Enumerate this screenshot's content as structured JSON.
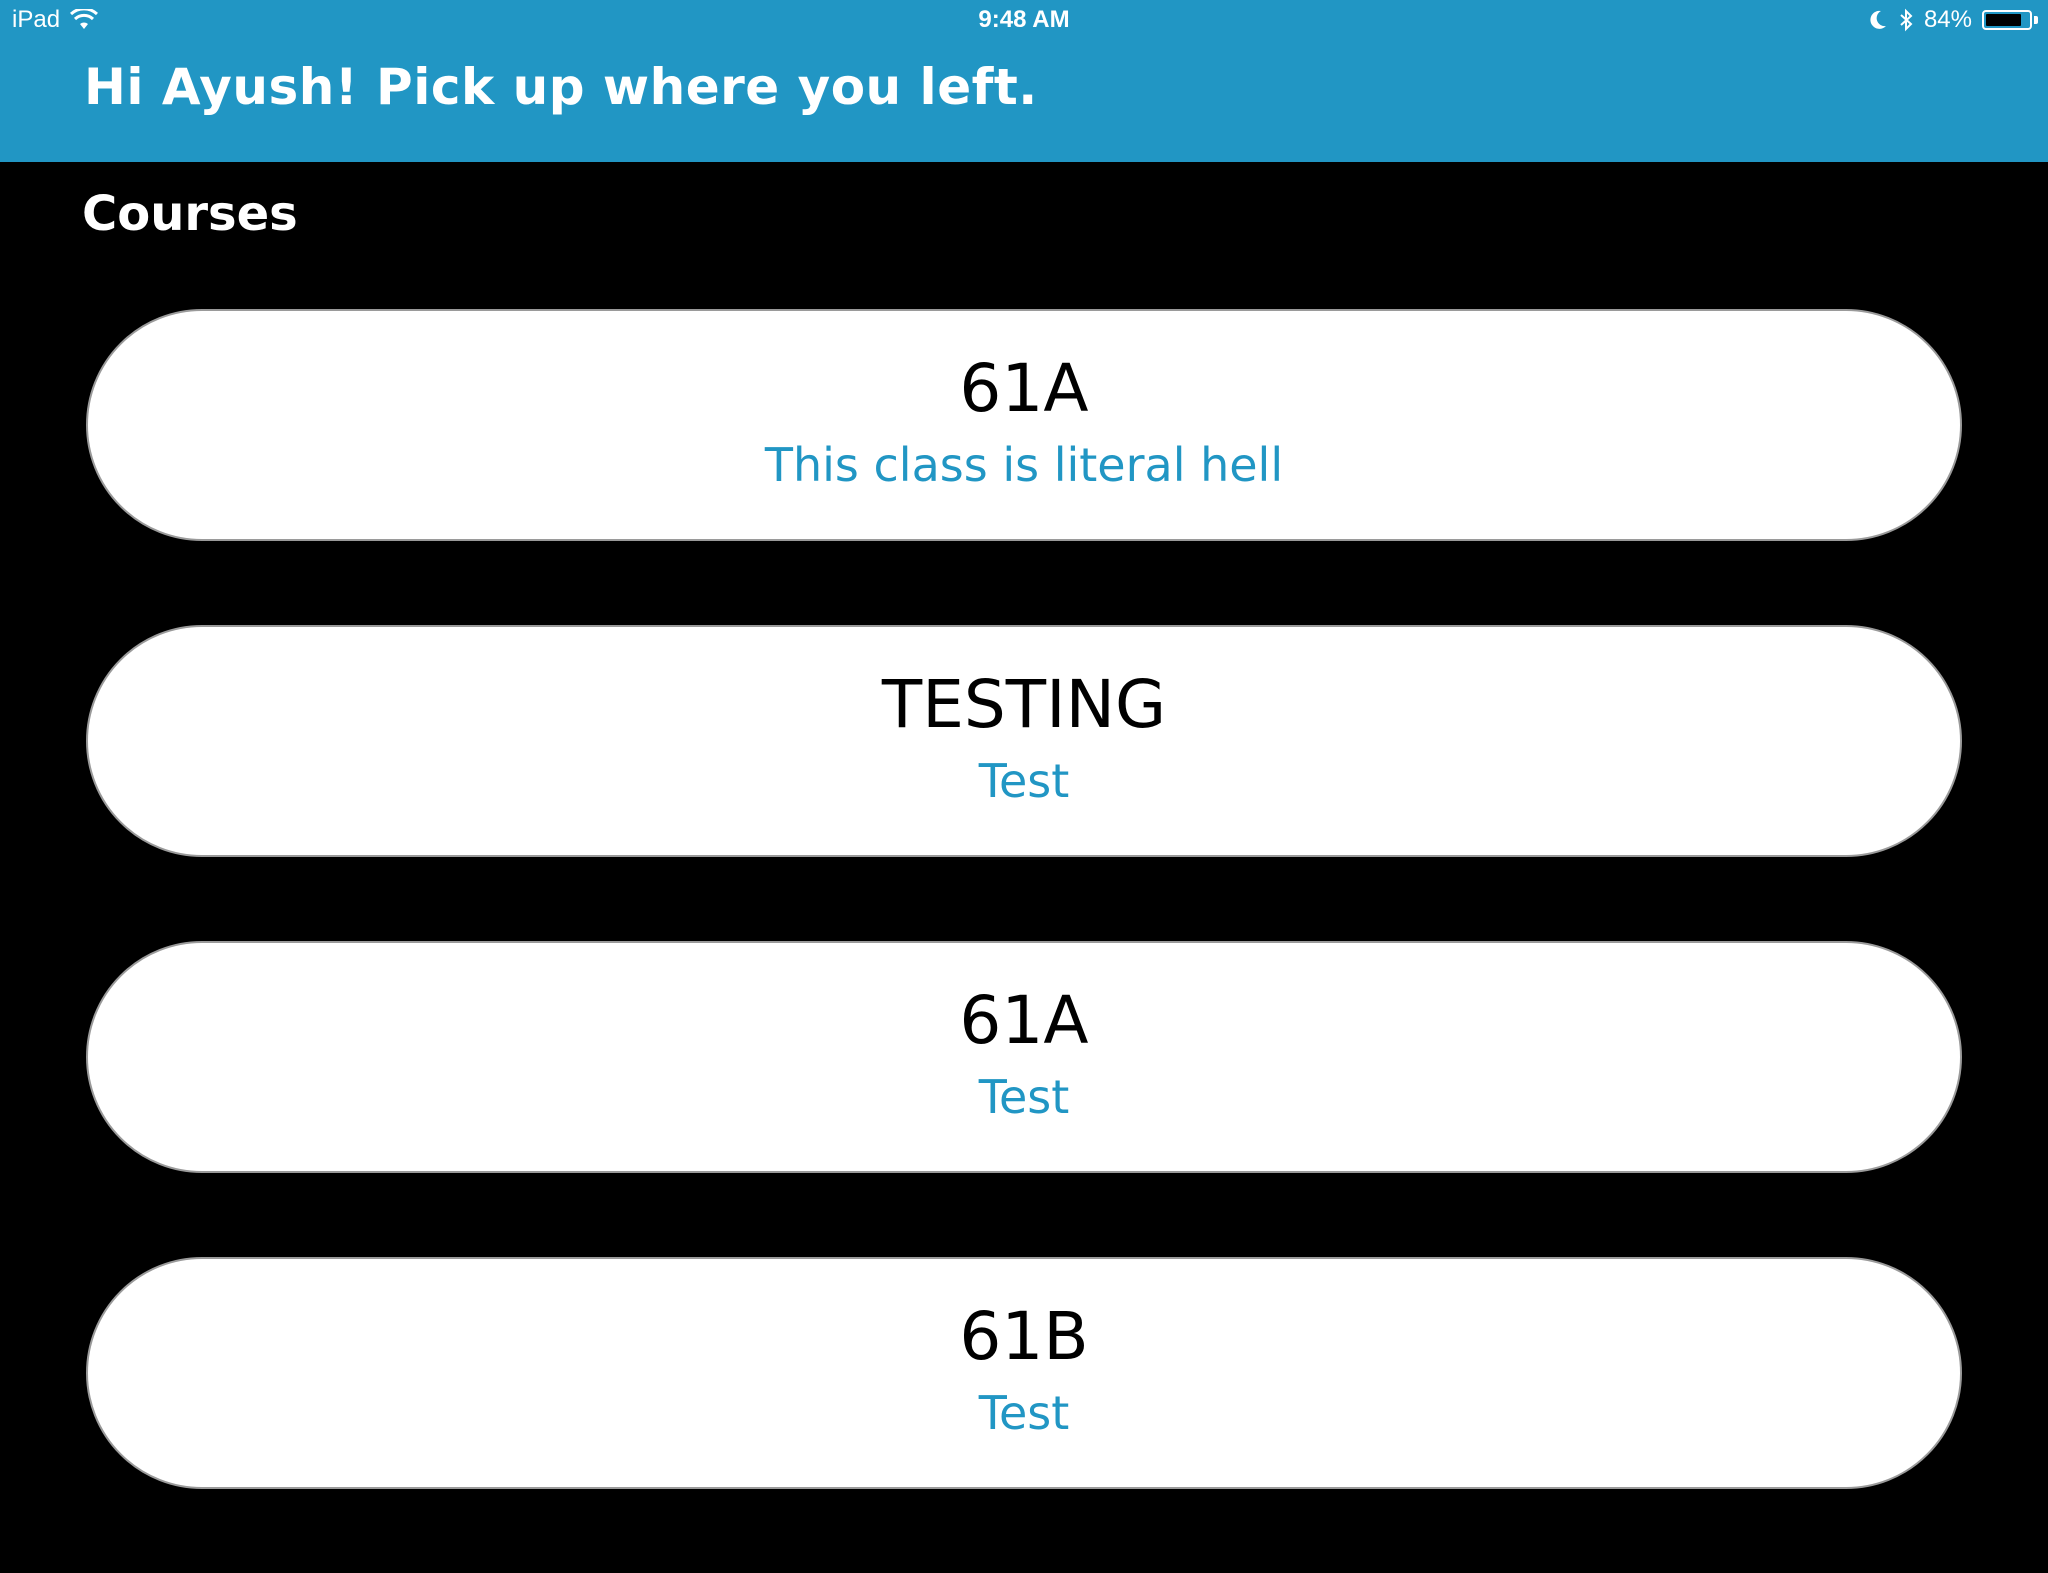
{
  "status_bar": {
    "device": "iPad",
    "time": "9:48 AM",
    "battery": "84%",
    "battery_level": 0.84,
    "icons": [
      "wifi-icon",
      "moon-icon",
      "bluetooth-icon",
      "battery-icon"
    ]
  },
  "header": {
    "greeting": "Hi Ayush! Pick up where you left.",
    "color": "#2196c4"
  },
  "courses_section": {
    "title": "Courses",
    "items": [
      {
        "code": "61A",
        "description": "This class is literal hell"
      },
      {
        "code": "TESTING",
        "description": "Test"
      },
      {
        "code": "61A",
        "description": "Test"
      },
      {
        "code": "61B",
        "description": "Test"
      }
    ]
  },
  "colors": {
    "accent": "#2196c4",
    "background": "#000000",
    "card": "#ffffff"
  }
}
